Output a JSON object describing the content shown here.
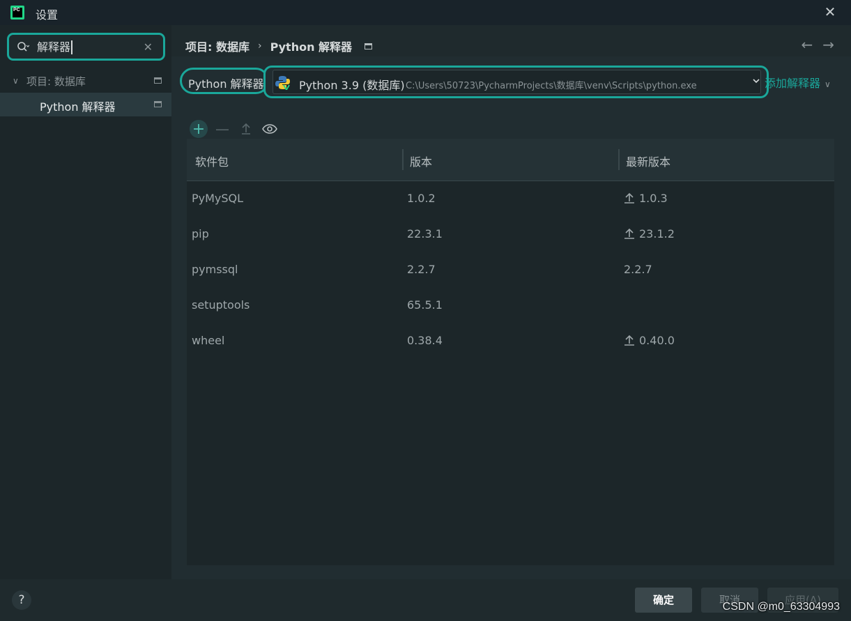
{
  "window": {
    "title": "设置",
    "logo_text": "PC"
  },
  "sidebar": {
    "search": {
      "value": "解释器"
    },
    "tree": [
      {
        "label": "项目: 数据库",
        "expanded": true
      },
      {
        "label": "Python 解释器",
        "selected": true
      }
    ]
  },
  "breadcrumb": {
    "parent": "项目: 数据库",
    "separator": "›",
    "current": "Python 解释器"
  },
  "interpreter": {
    "label": "Python 解释器:",
    "name": "Python 3.9 (数据库)",
    "path": "C:\\Users\\50723\\PycharmProjects\\数据库\\venv\\Scripts\\python.exe",
    "add_label": "添加解释器"
  },
  "table": {
    "headers": [
      "软件包",
      "版本",
      "最新版本"
    ],
    "rows": [
      {
        "package": "PyMySQL",
        "version": "1.0.2",
        "latest": "1.0.3",
        "upgrade": true
      },
      {
        "package": "pip",
        "version": "22.3.1",
        "latest": "23.1.2",
        "upgrade": true
      },
      {
        "package": "pymssql",
        "version": "2.2.7",
        "latest": "2.2.7",
        "upgrade": false
      },
      {
        "package": "setuptools",
        "version": "65.5.1",
        "latest": "",
        "upgrade": false
      },
      {
        "package": "wheel",
        "version": "0.38.4",
        "latest": "0.40.0",
        "upgrade": true
      }
    ]
  },
  "footer": {
    "help": "?",
    "ok": "确定",
    "cancel": "取消",
    "apply": "应用(A)",
    "watermark": "CSDN @m0_63304993"
  },
  "colors": {
    "accent": "#1aa79a",
    "background": "#1f2a2d",
    "sidebar": "#1c2629",
    "selected_row": "#2a3a3f"
  }
}
